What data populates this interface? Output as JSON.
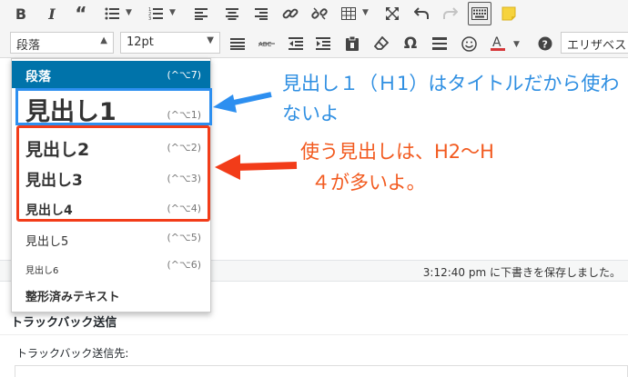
{
  "toolbar_row1": {
    "icons": [
      "bold-icon",
      "italic-icon",
      "blockquote-icon",
      "bullet-list-icon",
      "numbered-list-icon",
      "align-left-icon",
      "align-center-icon",
      "align-right-icon",
      "link-icon",
      "unlink-icon",
      "table-icon",
      "fullscreen-icon",
      "undo-icon",
      "redo-icon",
      "keyboard-icon",
      "sticky-note-icon"
    ]
  },
  "toolbar_row2": {
    "format_select": "段落",
    "font_size_select": "12pt",
    "lang_select": "エリザベス"
  },
  "format_menu": {
    "items": [
      {
        "label": "段落",
        "shortcut": "(^⌥7)"
      },
      {
        "label": "見出し1",
        "shortcut": "(^⌥1)"
      },
      {
        "label": "見出し2",
        "shortcut": "(^⌥2)"
      },
      {
        "label": "見出し3",
        "shortcut": "(^⌥3)"
      },
      {
        "label": "見出し4",
        "shortcut": "(^⌥4)"
      },
      {
        "label": "見出し5",
        "shortcut": "(^⌥5)"
      },
      {
        "label": "見出し6",
        "shortcut": "(^⌥6)"
      },
      {
        "label": "整形済みテキスト",
        "shortcut": ""
      }
    ]
  },
  "annotations": {
    "blue_note": "見出し１（Ｈ1）はタイトルだから使わないよ",
    "red_note_line1": "使う見出しは、H2〜H",
    "red_note_line2": "４が多いよ。",
    "blue_color": "#2d8ff0",
    "red_color": "#f23c19"
  },
  "status": {
    "saved_text": "3:12:40 pm に下書きを保存しました。"
  },
  "trackback": {
    "title": "トラックバック送信",
    "label": "トラックバック送信先:"
  }
}
